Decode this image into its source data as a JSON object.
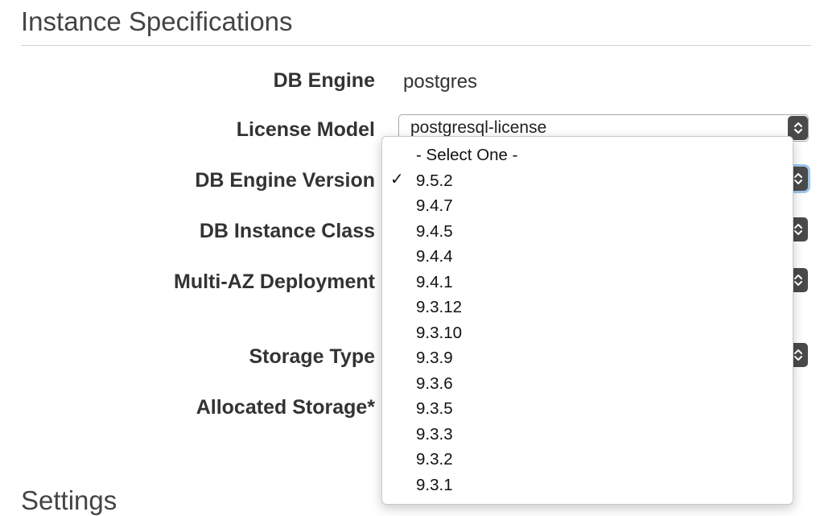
{
  "section": {
    "title": "Instance Specifications",
    "next_title": "Settings"
  },
  "fields": {
    "db_engine": {
      "label": "DB Engine",
      "value": "postgres"
    },
    "license_model": {
      "label": "License Model",
      "value": "postgresql-license"
    },
    "db_engine_version": {
      "label": "DB Engine Version"
    },
    "db_instance_class": {
      "label": "DB Instance Class"
    },
    "multi_az": {
      "label": "Multi-AZ Deployment"
    },
    "storage_type": {
      "label": "Storage Type"
    },
    "allocated_storage": {
      "label": "Allocated Storage*"
    }
  },
  "dropdown": {
    "selected": "9.5.2",
    "check_glyph": "✓",
    "options": [
      "- Select One -",
      "9.5.2",
      "9.4.7",
      "9.4.5",
      "9.4.4",
      "9.4.1",
      "9.3.12",
      "9.3.10",
      "9.3.9",
      "9.3.6",
      "9.3.5",
      "9.3.3",
      "9.3.2",
      "9.3.1"
    ]
  },
  "icons": {
    "stepper": "up-down-chevron-icon",
    "check": "checkmark-icon"
  },
  "colors": {
    "focus_ring": "#9fc6ee",
    "stepper_bg": "#4a4a4a"
  }
}
